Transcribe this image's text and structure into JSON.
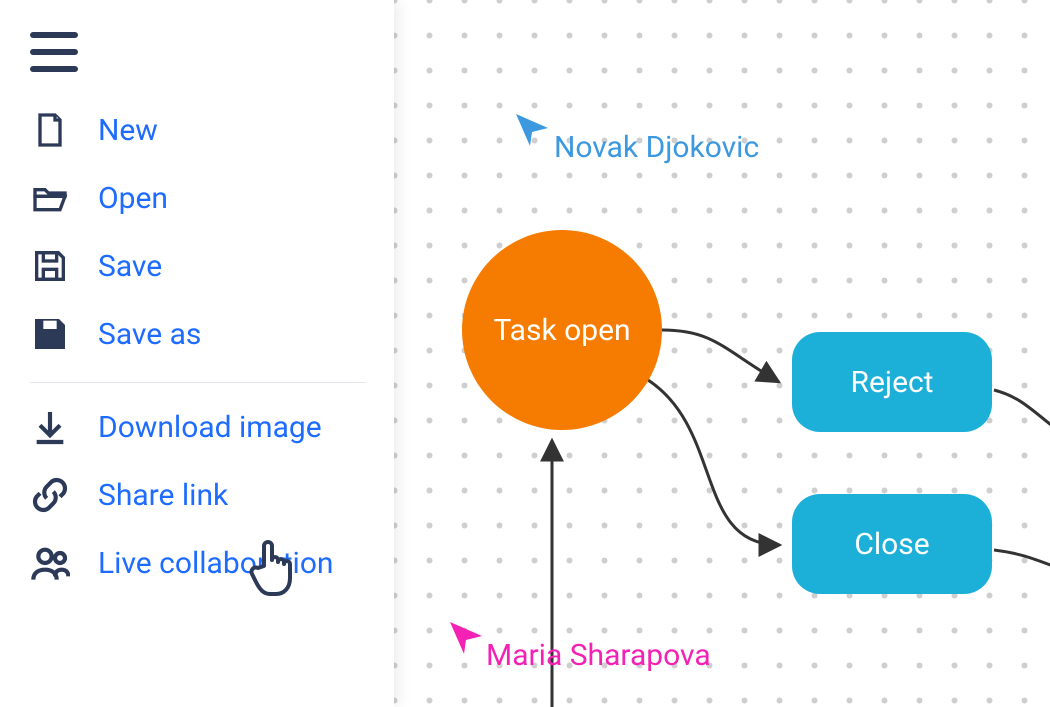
{
  "sidebar": {
    "items": [
      {
        "label": "New"
      },
      {
        "label": "Open"
      },
      {
        "label": "Save"
      },
      {
        "label": "Save as"
      }
    ],
    "items2": [
      {
        "label": "Download image"
      },
      {
        "label": "Share link"
      },
      {
        "label": "Live collaboration"
      }
    ]
  },
  "canvas": {
    "task_label": "Task open",
    "reject_label": "Reject",
    "close_label": "Close",
    "user1": "Novak Djokovic",
    "user2": "Maria Sharapova"
  }
}
